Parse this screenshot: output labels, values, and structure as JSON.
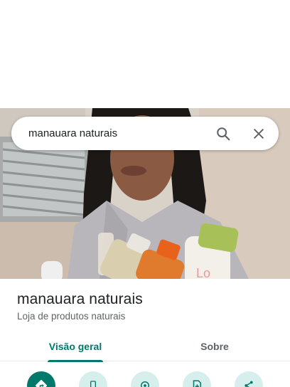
{
  "search": {
    "value": "manauara naturais",
    "search_icon": "search-icon",
    "clear_icon": "close-icon"
  },
  "place": {
    "name": "manauara naturais",
    "category": "Loja de produtos naturais"
  },
  "tabs": [
    {
      "label": "Visão geral",
      "active": true
    },
    {
      "label": "Sobre",
      "active": false
    }
  ],
  "actions": [
    {
      "icon": "directions-icon"
    },
    {
      "icon": "phone-icon"
    },
    {
      "icon": "location-icon"
    },
    {
      "icon": "add-document-icon"
    },
    {
      "icon": "share-icon"
    }
  ],
  "colors": {
    "accent": "#00796b",
    "action_bg": "#d7efec",
    "secondary_text": "#5f6368"
  }
}
